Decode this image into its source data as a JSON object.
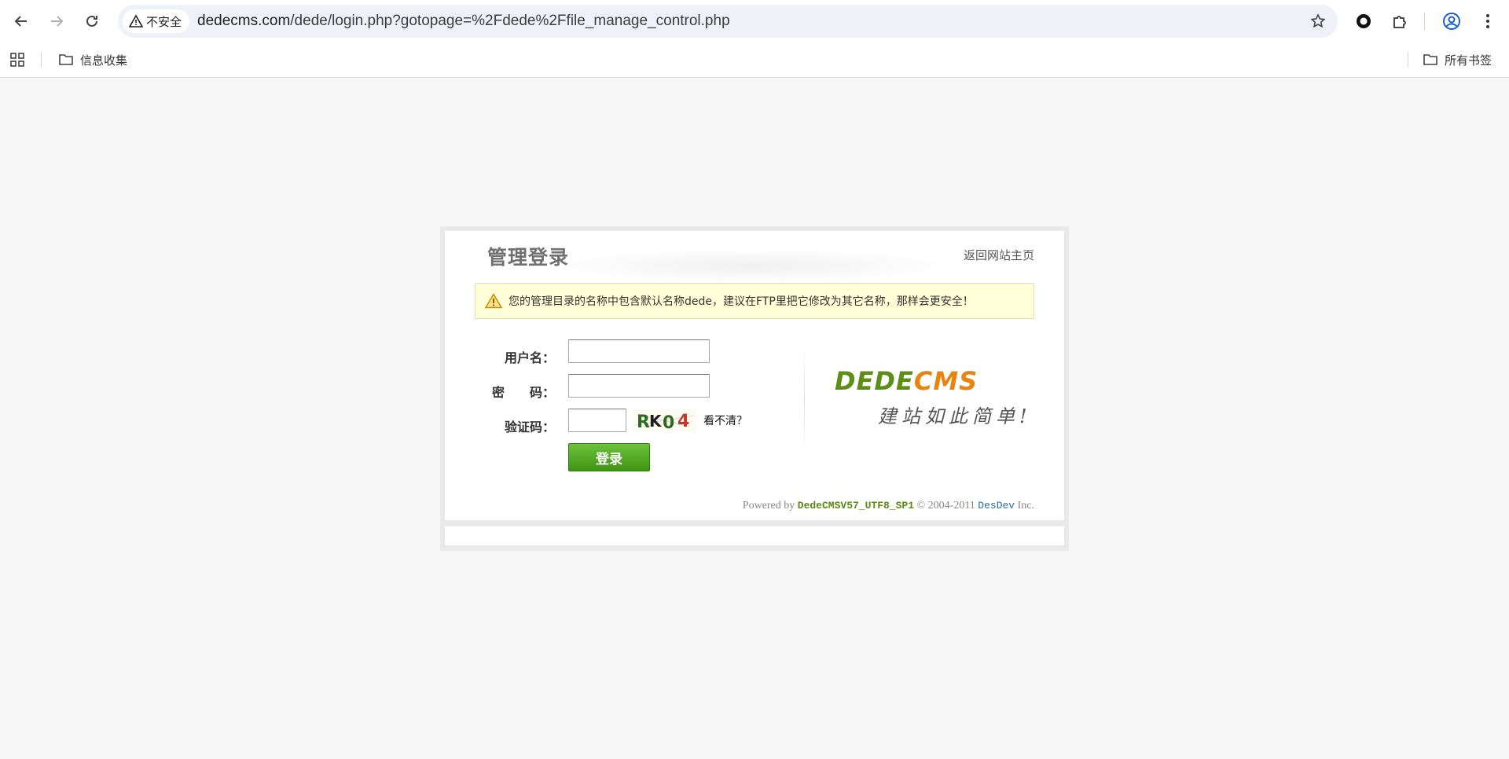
{
  "browser": {
    "security_label": "不安全",
    "url_host": "dedecms.com",
    "url_path": "/dede/login.php?gotopage=%2Fdede%2Ffile_manage_control.php",
    "bookmarks": [
      {
        "label": "信息收集"
      }
    ],
    "all_bookmarks_label": "所有书签"
  },
  "page": {
    "title": "管理登录",
    "back_link": "返回网站主页",
    "notice": "您的管理目录的名称中包含默认名称dede，建议在FTP里把它修改为其它名称，那样会更安全！",
    "form": {
      "username_label": "用户名：",
      "password_label": "密　　码：",
      "captcha_label": "验证码：",
      "username_value": "",
      "password_value": "",
      "captcha_value": "",
      "captcha_text": "RK04",
      "refresh_label": "看不清？",
      "submit_label": "登录"
    },
    "logo": {
      "dede": "DEDE",
      "cms": "CMS",
      "slogan": "建站如此简单!"
    },
    "footer": {
      "powered_prefix": "Powered by",
      "version": "DedeCMSV57_UTF8_SP1",
      "copyright": "© 2004-2011",
      "company": "DesDev",
      "suffix": "Inc."
    }
  },
  "colors": {
    "accent_green": "#5a8a10",
    "accent_orange": "#e9850f",
    "link_blue": "#2a6cb0",
    "notice_bg": "#ffffd8"
  }
}
